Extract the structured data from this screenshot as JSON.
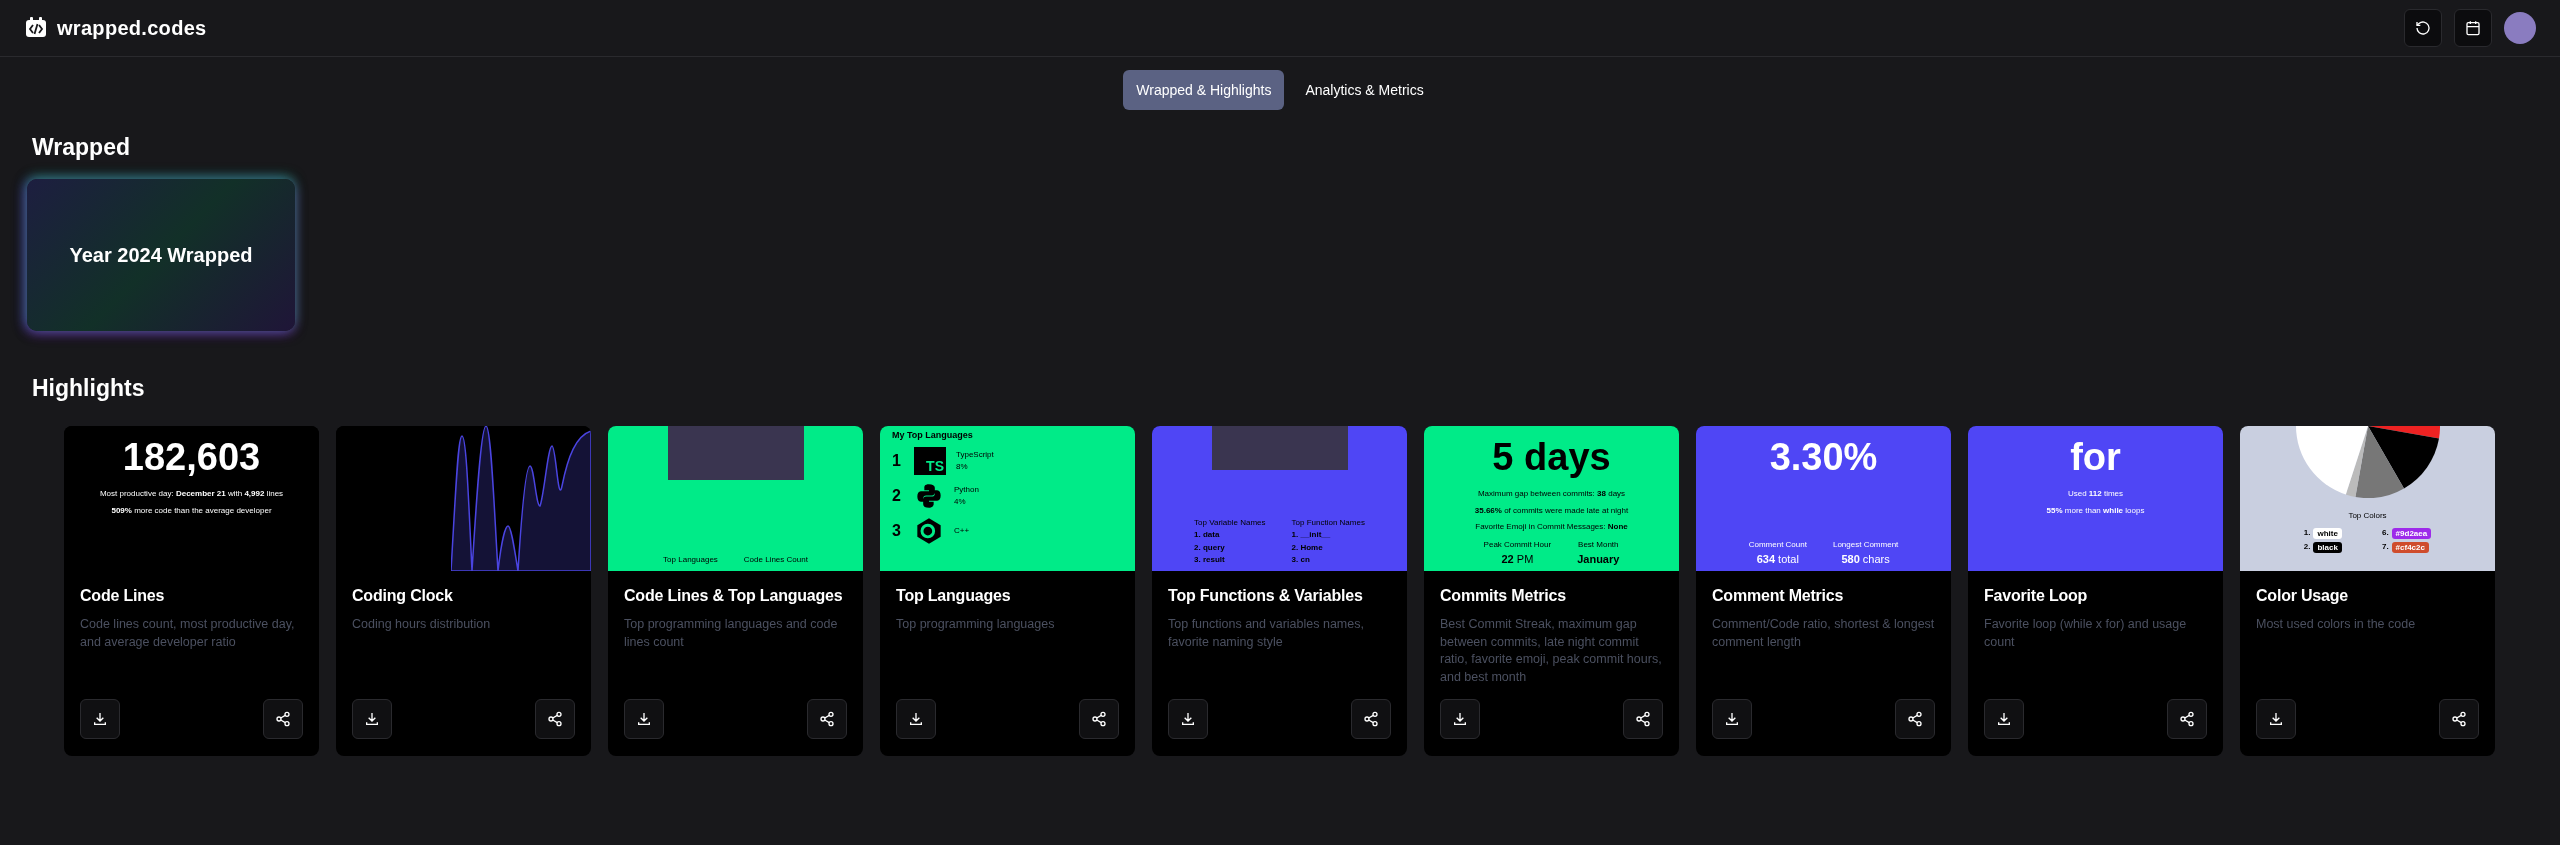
{
  "header": {
    "logo": "wrapped.codes"
  },
  "tabs": [
    {
      "label": "Wrapped & Highlights",
      "selected": true
    },
    {
      "label": "Analytics & Metrics",
      "selected": false
    }
  ],
  "wrapped": {
    "heading": "Wrapped",
    "card_title": "Year 2024 Wrapped"
  },
  "highlights": {
    "heading": "Highlights",
    "cards": [
      {
        "kind": "code-lines",
        "title": "Code Lines",
        "description": "Code lines count, most productive day, and average developer ratio",
        "preview": {
          "value": "182,603",
          "lines": [
            "Most productive day: **December 21** with **4,992** lines",
            "**509%** more code than the average developer"
          ]
        }
      },
      {
        "kind": "clock",
        "title": "Coding Clock",
        "description": "Coding hours distribution"
      },
      {
        "kind": "code-lines-languages",
        "title": "Code Lines & Top Languages",
        "description": "Top programming languages and code lines count",
        "preview": {
          "labels": [
            "Top Languages",
            "Code Lines Count"
          ]
        }
      },
      {
        "kind": "languages",
        "title": "Top Languages",
        "description": "Top programming languages",
        "preview": {
          "heading": "My Top Languages",
          "rows": [
            {
              "rank": "1",
              "kind": "ts",
              "icon_text": "TS",
              "name": "TypeScript",
              "share": "8%"
            },
            {
              "rank": "2",
              "kind": "python",
              "name": "Python",
              "share": "4%"
            },
            {
              "rank": "3",
              "kind": "cpp",
              "name": "C++"
            }
          ]
        }
      },
      {
        "kind": "names",
        "title": "Top Functions & Variables",
        "description": "Top functions and variables names, favorite naming style",
        "preview": {
          "lists": [
            {
              "heading": "Top Variable Names",
              "items": [
                "1. data",
                "2. query",
                "3. result"
              ]
            },
            {
              "heading": "Top Function Names",
              "items": [
                "1. __init__",
                "2. Home",
                "3. cn"
              ]
            }
          ]
        }
      },
      {
        "kind": "commits",
        "title": "Commits Metrics",
        "description": "Best Commit Streak, maximum gap between commits, late night commit ratio, favorite emoji, peak commit hours, and best month",
        "preview": {
          "value": "5 days",
          "lines": [
            "Maximum gap between commits: **38** days",
            "**35.66%** of commits were made late at night",
            "Favorite Emoji in Commit Messages: **None**"
          ],
          "stats": [
            {
              "label": "Peak Commit Hour",
              "value": "**22** PM"
            },
            {
              "label": "Best Month",
              "value": "**January**"
            }
          ]
        }
      },
      {
        "kind": "comments",
        "title": "Comment Metrics",
        "description": "Comment/Code ratio, shortest & longest comment length",
        "preview": {
          "value": "3.30%",
          "stats": [
            {
              "label": "Comment Count",
              "value": "**634** total"
            },
            {
              "label": "Longest Comment",
              "value": "**580** chars"
            }
          ]
        }
      },
      {
        "kind": "loop",
        "title": "Favorite Loop",
        "description": "Favorite loop (while x for) and usage count",
        "preview": {
          "value": "for",
          "lines": [
            "Used **112** times",
            "**55%** more than **while** loops"
          ]
        }
      },
      {
        "kind": "colors",
        "title": "Color Usage",
        "description": "Most used colors in the code",
        "preview": {
          "heading": "Top Colors",
          "chips": [
            {
              "rank": "1.",
              "label": "white",
              "color": "#ffffff"
            },
            {
              "rank": "6.",
              "label": "#9d2aea",
              "color": "#9d2aea"
            },
            {
              "rank": "2.",
              "label": "black",
              "color": "#000000"
            },
            {
              "rank": "7.",
              "label": "#cf4c2c",
              "color": "#cf4c2c"
            }
          ]
        }
      }
    ]
  }
}
